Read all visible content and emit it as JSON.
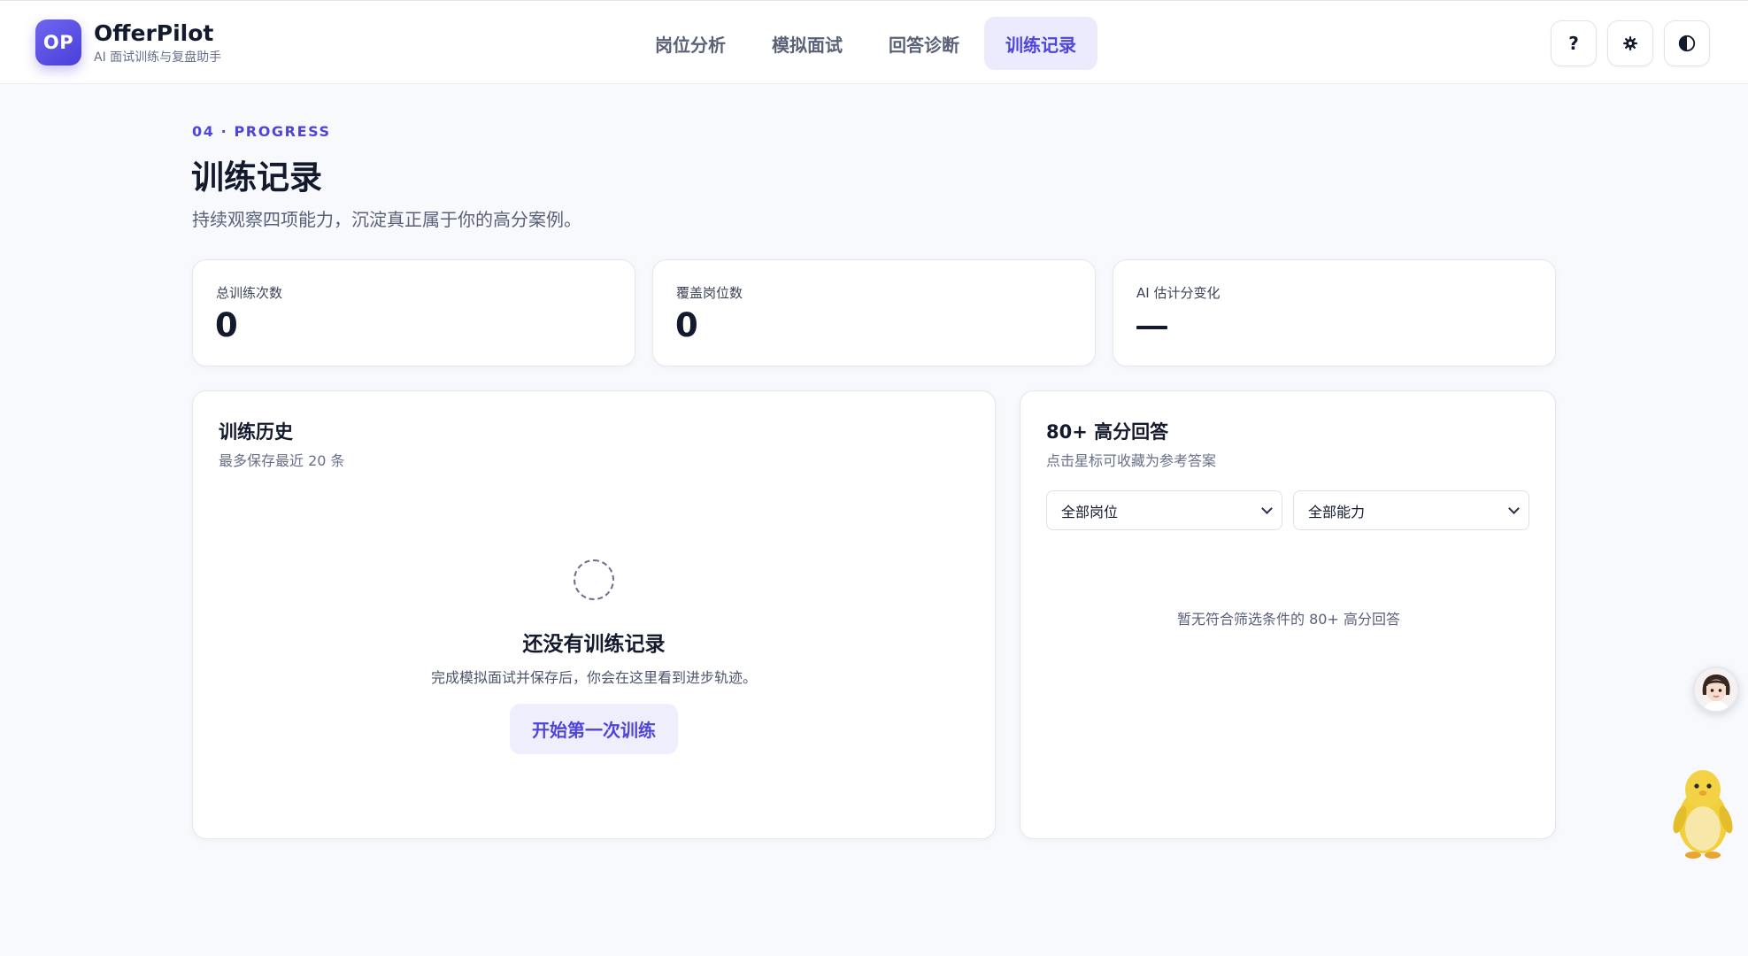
{
  "brand": {
    "logo_text": "OP",
    "name": "OfferPilot",
    "tagline": "AI 面试训练与复盘助手"
  },
  "nav": {
    "items": [
      {
        "label": "岗位分析",
        "active": false
      },
      {
        "label": "模拟面试",
        "active": false
      },
      {
        "label": "回答诊断",
        "active": false
      },
      {
        "label": "训练记录",
        "active": true
      }
    ]
  },
  "header_buttons": {
    "help": "?",
    "settings_icon": "gear-icon",
    "theme_icon": "contrast-icon"
  },
  "page": {
    "eyebrow": "04 · PROGRESS",
    "title": "训练记录",
    "subtitle": "持续观察四项能力，沉淀真正属于你的高分案例。"
  },
  "stats": [
    {
      "label": "总训练次数",
      "value": "0"
    },
    {
      "label": "覆盖岗位数",
      "value": "0"
    },
    {
      "label": "AI 估计分变化",
      "value": "—"
    }
  ],
  "history": {
    "title": "训练历史",
    "subtitle": "最多保存最近 20 条",
    "empty_title": "还没有训练记录",
    "empty_desc": "完成模拟面试并保存后，你会在这里看到进步轨迹。",
    "cta_label": "开始第一次训练"
  },
  "top_answers": {
    "title": "80+ 高分回答",
    "subtitle": "点击星标可收藏为参考答案",
    "filter_role": "全部岗位",
    "filter_skill": "全部能力",
    "empty_text": "暂无符合筛选条件的 80+ 高分回答"
  },
  "colors": {
    "accent": "#4f45d8",
    "accent_soft": "#ecebfd",
    "background": "#f8f9fc",
    "text": "#141a2e"
  }
}
